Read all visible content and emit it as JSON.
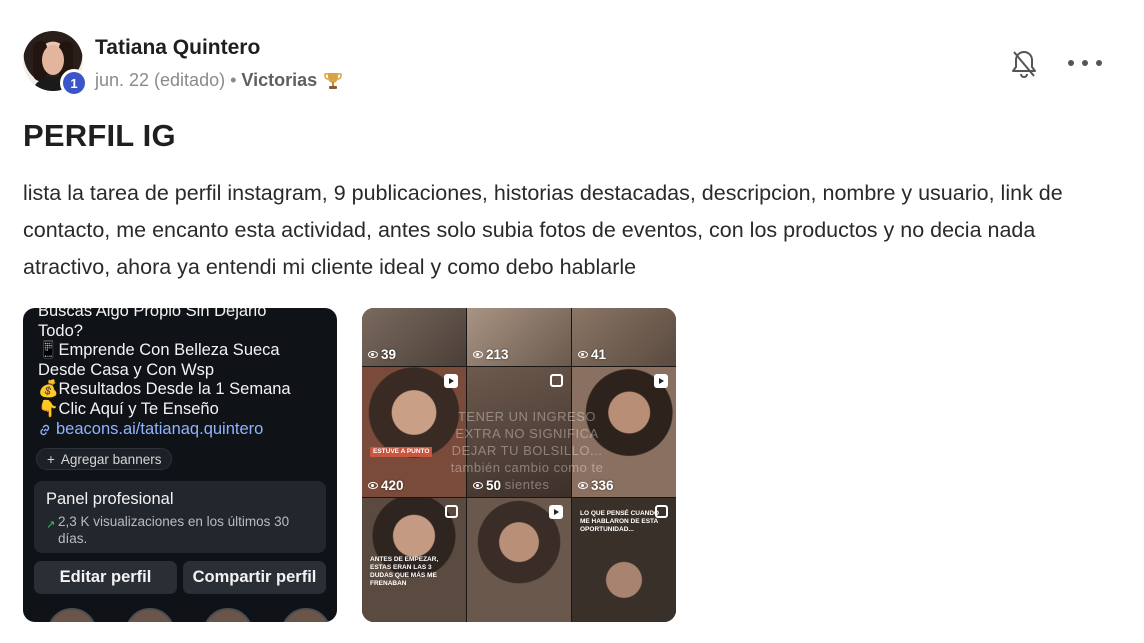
{
  "author": {
    "name": "Tatiana Quintero",
    "level": "1"
  },
  "meta": {
    "date": "jun. 22 (editado)",
    "separator": "•",
    "category": "Victorias"
  },
  "icons": {
    "notification": "bell-off-icon",
    "more": "more-horizontal-icon",
    "trophy": "trophy-icon"
  },
  "post": {
    "title": "PERFIL IG",
    "body": "lista la tarea de perfil instagram, 9 publicaciones, historias destacadas, descripcion, nombre y usuario, link de contacto, me encanto esta actividad, antes solo subia fotos de eventos, con los productos y no decia nada atractivo, ahora ya entendi mi cliente ideal y como debo hablarle"
  },
  "image1": {
    "bio_lines": [
      "Buscas Algo Propio Sin Dejarlo",
      "Todo?",
      "📱Emprende Con Belleza Sueca",
      "Desde Casa y Con Wsp",
      " 💰Resultados Desde la 1 Semana",
      "👇Clic Aquí y Te Enseño"
    ],
    "link": "beacons.ai/tatianaq.quintero",
    "chip": "Agregar banners",
    "panel_title": "Panel profesional",
    "panel_sub": "2,3 K visualizaciones en los últimos 30 días.",
    "edit_button": "Editar perfil",
    "share_button": "Compartir perfil"
  },
  "image2": {
    "views": [
      "39",
      "213",
      "41",
      "420",
      "50",
      "336"
    ],
    "ghost_text": "TENER UN INGRESO EXTRA NO SIGNIFICA DEJAR TU BOLSILLO... también cambio como te sientes",
    "overlay_cell4": "ESTUVE A PUNTO",
    "overlay_cell7": "ANTES DE EMPEZAR, ESTAS ERAN LAS 3 DUDAS QUE MÁS ME FRENABAN",
    "overlay_cell9": "LO QUE PENSÉ CUANDO ME HABLARON DE ESTA OPORTUNIDAD..."
  },
  "colors": {
    "level_badge": "#3b55c9",
    "link_blue": "#8fb4ff",
    "dark_bg": "#0f1217"
  }
}
